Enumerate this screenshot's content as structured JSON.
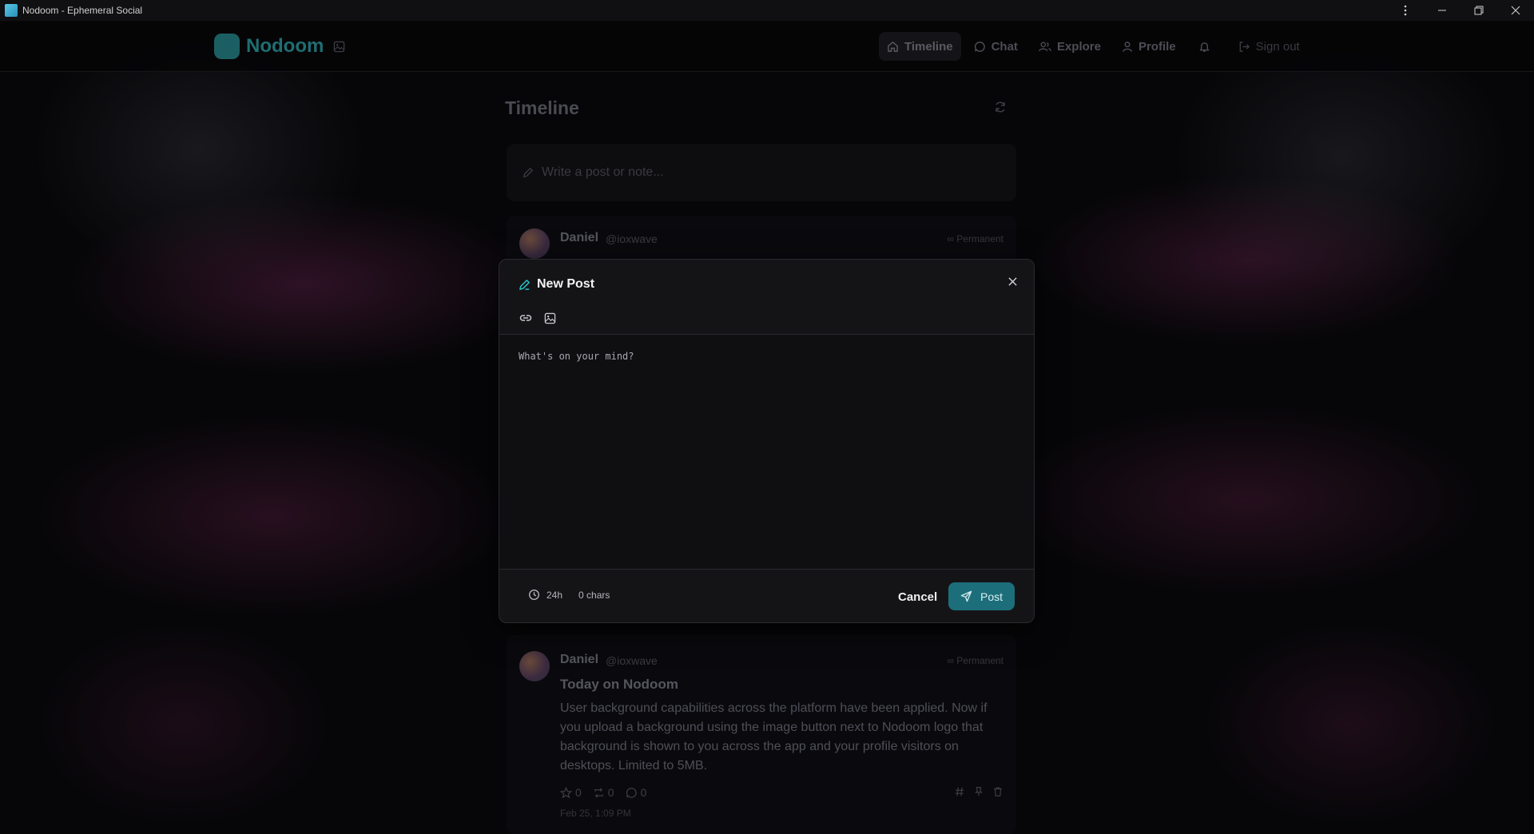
{
  "window": {
    "title": "Nodoom - Ephemeral Social",
    "menu_icon": "more-vertical-icon",
    "minimize_icon": "minimize-icon",
    "restore_icon": "restore-icon",
    "close_icon": "close-icon"
  },
  "header": {
    "brand_name": "Nodoom",
    "nav": [
      {
        "label": "Timeline",
        "icon": "home-icon",
        "active": true
      },
      {
        "label": "Chat",
        "icon": "chat-bubble-icon"
      },
      {
        "label": "Explore",
        "icon": "users-icon"
      },
      {
        "label": "Profile",
        "icon": "user-icon"
      },
      {
        "label": "",
        "icon": "bell-icon"
      },
      {
        "label": "Sign out",
        "icon": "sign-out-icon"
      }
    ]
  },
  "timeline": {
    "title": "Timeline",
    "composer_placeholder": "Write a post or note..."
  },
  "posts": [
    {
      "author": "Daniel",
      "handle": "@ioxwave",
      "badge": "∞ Permanent"
    },
    {
      "author": "Daniel",
      "handle": "@ioxwave",
      "badge": "∞ Permanent",
      "heading": "Today on Nodoom",
      "body": "User background capabilities across the platform have been applied. Now if you upload a background using the image button next to Nodoom logo that background is shown to you across the app and your profile visitors on desktops. Limited to 5MB.",
      "stars": "0",
      "reposts": "0",
      "comments": "0",
      "date": "Feb 25, 1:09 PM"
    }
  ],
  "modal": {
    "title": "New Post",
    "placeholder": "What's on your mind?",
    "ttl": "24h",
    "char_count": "0 chars",
    "cancel_label": "Cancel",
    "post_label": "Post"
  },
  "colors": {
    "accent": "#1c6f7a",
    "brand": "#1f6e73",
    "modal_bg": "#141417"
  }
}
